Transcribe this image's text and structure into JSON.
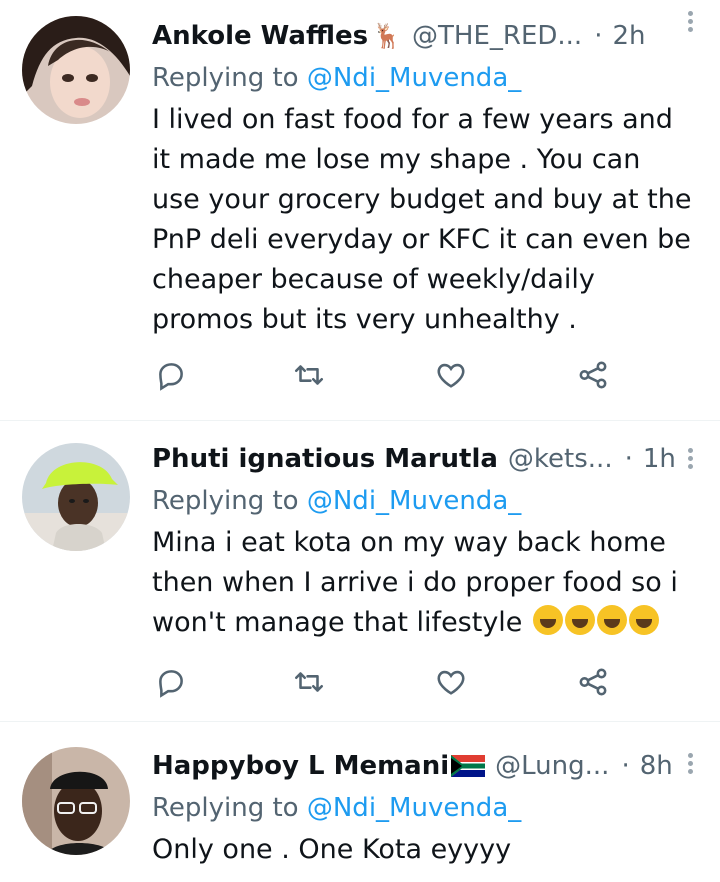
{
  "tweets": [
    {
      "name": "Ankole Waffles",
      "name_emoji": "🦌",
      "handle": "@THE_RED...",
      "separator": "·",
      "time": "2h",
      "replying_prefix": "Replying to ",
      "replying_to": "@Ndi_Muvenda_",
      "text": "I lived on fast food for a few years and it made me lose my shape .  You can use your grocery budget and buy at the PnP deli everyday or KFC it can even be cheaper because of weekly/daily promos but its very unhealthy ."
    },
    {
      "name": "Phuti ignatious Marutla",
      "handle": "@kets...",
      "separator": "·",
      "time": "1h",
      "replying_prefix": "Replying to ",
      "replying_to": "@Ndi_Muvenda_",
      "text": "Mina i eat kota on my way back home then when I arrive i do proper food so i won't manage that lifestyle ",
      "trailing_emoji": "😂😂😂😂"
    },
    {
      "name": "Happyboy L Memani",
      "name_emoji": "flag-south-africa",
      "handle": "@Lung...",
      "separator": "·",
      "time": "8h",
      "replying_prefix": "Replying to ",
      "replying_to": "@Ndi_Muvenda_",
      "text": "Only one . One Kota  eyyyy"
    }
  ],
  "colors": {
    "text": "#0f1419",
    "secondary": "#536471",
    "link": "#1d9bf0",
    "divider": "#eff3f4"
  },
  "action_icons": [
    "reply-icon",
    "retweet-icon",
    "like-icon",
    "share-icon"
  ]
}
